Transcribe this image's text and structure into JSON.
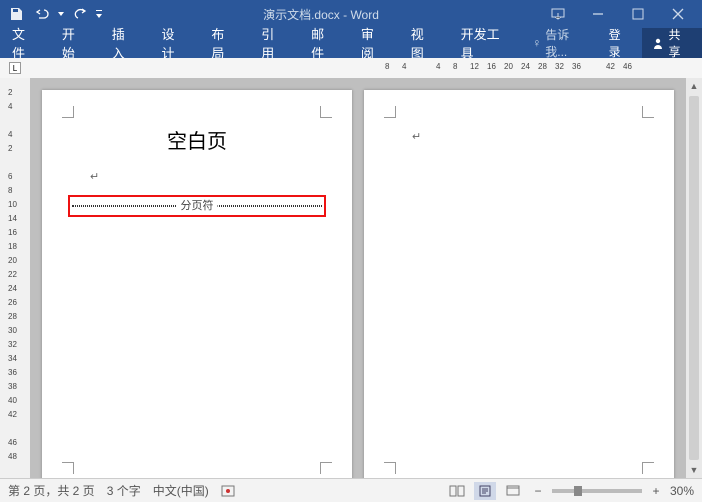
{
  "titlebar": {
    "title": "演示文档.docx - Word"
  },
  "ribbon": {
    "file": "文件",
    "home": "开始",
    "insert": "插入",
    "design": "设计",
    "layout": "布局",
    "references": "引用",
    "mailings": "邮件",
    "review": "审阅",
    "view": "视图",
    "developer": "开发工具",
    "tellme": "告诉我...",
    "login": "登录",
    "share": "共享"
  },
  "ruler_h": [
    "8",
    "4",
    "",
    "4",
    "8",
    "12",
    "16",
    "20",
    "24",
    "28",
    "32",
    "36",
    "",
    "42",
    "46"
  ],
  "ruler_v": [
    "2",
    "4",
    "",
    "4",
    "2",
    "",
    "6",
    "8",
    "10",
    "14",
    "16",
    "18",
    "20",
    "22",
    "24",
    "26",
    "28",
    "30",
    "32",
    "34",
    "36",
    "38",
    "40",
    "42",
    "",
    "46",
    "48"
  ],
  "doc": {
    "heading": "空白页",
    "pagebreak_label": "分页符",
    "para_mark": "↵"
  },
  "status": {
    "page": "第 2 页，共 2 页",
    "words": "3 个字",
    "lang": "中文(中国)",
    "zoom": "30%"
  }
}
